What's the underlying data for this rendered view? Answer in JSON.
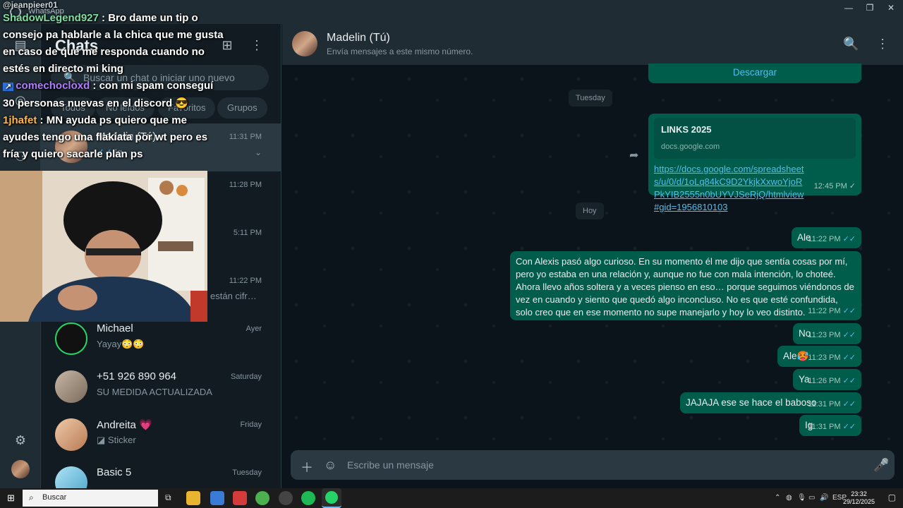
{
  "window": {
    "app_title": "WhatsApp"
  },
  "sidebar": {
    "heading": "Chats"
  },
  "search": {
    "placeholder": "Buscar un chat o iniciar uno nuevo"
  },
  "filters": [
    {
      "label": "Todos"
    },
    {
      "label": "No leídos"
    },
    {
      "label": "Favoritos"
    },
    {
      "label": "Grupos"
    }
  ],
  "chats": [
    {
      "name": "Madelin (Tú)",
      "time": "11:31 PM",
      "preview": "Ig"
    },
    {
      "name": "",
      "time": "11:28 PM",
      "preview": ""
    },
    {
      "name": "",
      "time": "5:11 PM",
      "preview": ""
    },
    {
      "name": "",
      "time": "11:22 PM",
      "preview": "están cifr…"
    },
    {
      "name": "Michael",
      "time": "Ayer",
      "preview": "Yayay😳😳"
    },
    {
      "name": "+51 926 890 964",
      "time": "Saturday",
      "preview": "SU MEDIDA ACTUALIZADA"
    },
    {
      "name": "Andreita 💗",
      "time": "Friday",
      "preview": "Sticker"
    },
    {
      "name": "Basic 5",
      "time": "Tuesday",
      "preview": ""
    }
  ],
  "conversation": {
    "title": "Madelin (Tú)",
    "subtitle": "Envía mensajes a este mismo número.",
    "download_label": "Descargar",
    "day_tuesday": "Tuesday",
    "day_today": "Hoy",
    "link_title": "LINKS 2025",
    "link_domain": "docs.google.com",
    "link_url": "https://docs.google.com/spreadsheets/u/0/d/1oLq84kC9D2YkjkXxwoYjoRPkYIB2555n0bUYVJSeRjQ/htmlview#gid=1956810103",
    "link_time": "12:45 PM",
    "messages": [
      {
        "text": "Ale",
        "time": "11:22 PM"
      },
      {
        "text": "Con Alexis pasó algo curioso. En su momento él me dijo que sentía cosas por mí, pero yo estaba en una relación y, aunque no fue con mala intención, lo choteé. Ahora llevo años soltera y a veces pienso en eso… porque seguimos viéndonos de vez en cuando y siento que quedó algo inconcluso. No es que esté confundida, solo creo que en ese momento no supe manejarlo y hoy lo veo distinto.",
        "time": "11:22 PM"
      },
      {
        "text": "No",
        "time": "11:23 PM"
      },
      {
        "text": "Ale🥵",
        "time": "11:23 PM"
      },
      {
        "text": "Ya",
        "time": "11:26 PM"
      },
      {
        "text": "JAJAJA ese se hace el baboso",
        "time": "11:31 PM"
      },
      {
        "text": "Ig",
        "time": "11:31 PM"
      }
    ],
    "composer_placeholder": "Escribe un mensaje"
  },
  "stream_overlay": {
    "top_handle": "@jeanpieer01",
    "lines": [
      {
        "user": "ShadowLegend927",
        "color": "#7ee0a0",
        "text": "Bro dame un tip o consejo pa hablarle a la chica que me gusta en caso de que me responda cuando no estés en directo mi king"
      },
      {
        "user": "comechocloxd",
        "color": "#b07cff",
        "text": "con mi spam conseguí 30 personas nuevas en el discord 😎"
      },
      {
        "user": "1jhafet",
        "color": "#ffb84d",
        "text": "MN ayuda ps quiero que me ayudes tengo una flakiata por wt pero es fría y quiero sacarle plan ps"
      }
    ]
  },
  "taskbar": {
    "search_placeholder": "Buscar",
    "language": "ESP",
    "clock_time": "23:32",
    "clock_date": "29/12/2025"
  },
  "colors": {
    "bubble_out": "#005c4b",
    "read_tick": "#53bdeb",
    "panel": "#111b21"
  }
}
